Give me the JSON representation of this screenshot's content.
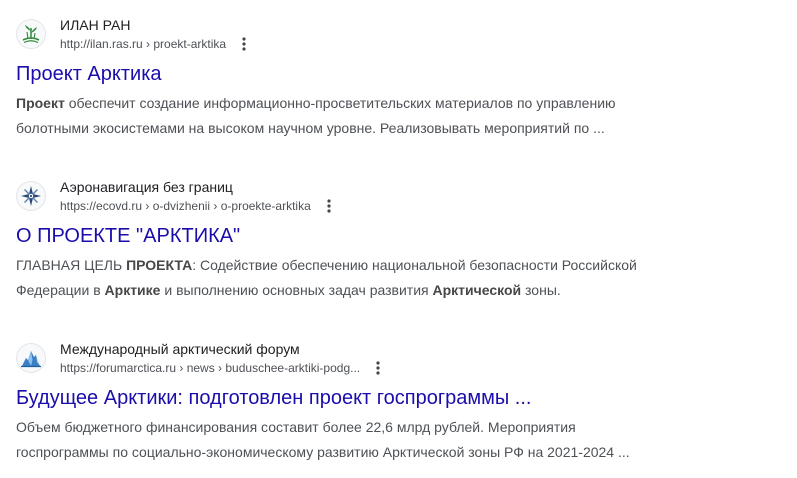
{
  "results": [
    {
      "site_name": "ИЛАН РАН",
      "url": "http://ilan.ras.ru › proekt-arktika",
      "title": "Проект Арктика",
      "snippet_line1": [
        {
          "text": "Проект",
          "bold": true
        },
        {
          "text": " обеспечит создание информационно-просветительских материалов по управлению",
          "bold": false
        }
      ],
      "snippet_line2": [
        {
          "text": "болотными экосистемами на высоком научном уровне. Реализовывать мероприятий по ...",
          "bold": false
        }
      ],
      "favicon_icon": "swamp-plant-logo-icon",
      "favicon_color": "#2e8b3a"
    },
    {
      "site_name": "Аэронавигация без границ",
      "url": "https://ecovd.ru › o-dvizhenii › o-proekte-arktika",
      "title": "О ПРОЕКТЕ \"АРКТИКА\"",
      "snippet_line1": [
        {
          "text": "ГЛАВНАЯ ЦЕЛЬ ",
          "bold": false
        },
        {
          "text": "ПРОЕКТА",
          "bold": true
        },
        {
          "text": ": Содействие обеспечению национальной безопасности Российской",
          "bold": false
        }
      ],
      "snippet_line2": [
        {
          "text": "Федерации в ",
          "bold": false
        },
        {
          "text": "Арктике",
          "bold": true
        },
        {
          "text": " и выполнению основных задач развития ",
          "bold": false
        },
        {
          "text": "Арктической",
          "bold": true
        },
        {
          "text": " зоны.",
          "bold": false
        }
      ],
      "favicon_icon": "compass-star-icon",
      "favicon_color": "#2b4a7a"
    },
    {
      "site_name": "Международный арктический форум",
      "url": "https://forumarctica.ru › news › buduschee-arktiki-podg...",
      "title": "Будущее Арктики: подготовлен проект госпрограммы ...",
      "snippet_line1": [
        {
          "text": "Объем бюджетного финансирования составит более 22,6 млрд рублей. Мероприятия",
          "bold": false
        }
      ],
      "snippet_line2": [
        {
          "text": "госпрограммы по социально-экономическому развитию Арктической зоны РФ на 2021-2024 ...",
          "bold": false
        }
      ],
      "favicon_icon": "iceberg-icon",
      "favicon_color": "#3a7fc4"
    }
  ],
  "colors": {
    "link": "#1a0dab",
    "site_name": "#202124",
    "url": "#4d5156",
    "snippet": "#4d5156"
  }
}
